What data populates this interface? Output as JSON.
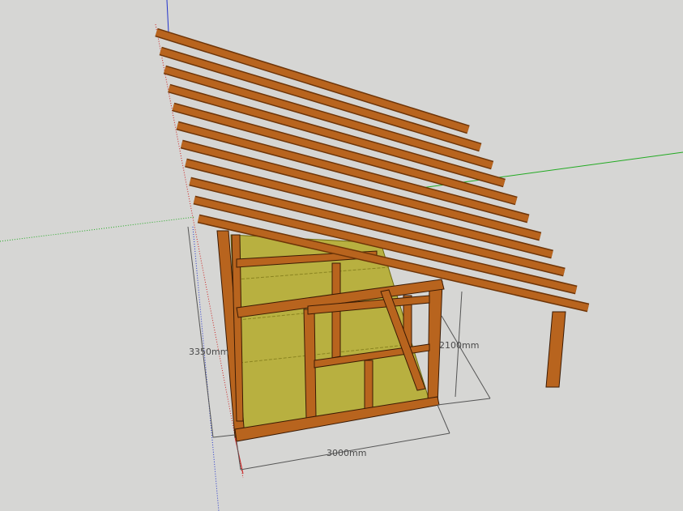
{
  "viewport": {
    "background": "#d6d6d4",
    "rafter_count": 11
  },
  "dimensions": {
    "width": "3000mm",
    "height_back": "3350mm",
    "height_front": "2100mm"
  },
  "colors": {
    "timber": "#b8641e",
    "timber_dark": "#6e3508",
    "floor": "#b8b040",
    "axis_red": "#cc2222",
    "axis_green": "#22aa22",
    "axis_blue": "#2233cc"
  }
}
